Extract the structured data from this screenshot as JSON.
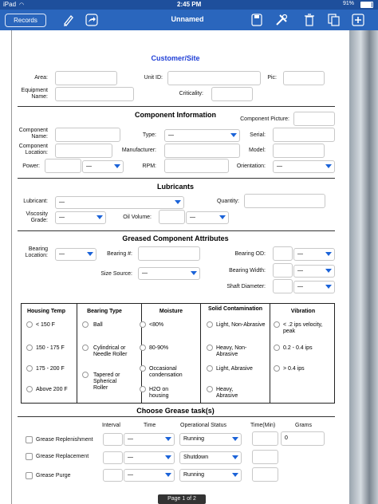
{
  "status": {
    "device": "iPad",
    "time": "2:45 PM",
    "battery": "91%"
  },
  "toolbar": {
    "records": "Records",
    "title": "Unnamed"
  },
  "customer": {
    "title": "Customer/Site",
    "area": "Area:",
    "unit_id": "Unit ID:",
    "pic": "Pic:",
    "equipment_name": "Equipment Name:",
    "criticality": "Criticality:"
  },
  "component": {
    "title": "Component Information",
    "picture": "Component Picture:",
    "name": "Component Name:",
    "type": "Type:",
    "type_value": "—",
    "serial": "Serial:",
    "location": "Component Location:",
    "manufacturer": "Manufacturer:",
    "model": "Model:",
    "power": "Power:",
    "power_unit": "—",
    "rpm": "RPM:",
    "orientation": "Orientation:",
    "orientation_value": "—"
  },
  "lubricants": {
    "title": "Lubricants",
    "lubricant": "Lubricant:",
    "lubricant_value": "—",
    "quantity": "Quantity:",
    "viscosity": "Viscosity Grade:",
    "viscosity_value": "—",
    "oil_volume": "Oil Volume:",
    "oil_volume_unit": "—"
  },
  "greased": {
    "title": "Greased Component Attributes",
    "bearing_location": "Bearing Location:",
    "bearing_location_value": "—",
    "bearing_no": "Bearing #:",
    "bearing_od": "Bearing OD:",
    "bearing_od_unit": "—",
    "size_source": "Size Source:",
    "size_source_value": "—",
    "bearing_width": "Bearing Width:",
    "bearing_width_unit": "—",
    "shaft_diameter": "Shaft Diameter:",
    "shaft_diameter_unit": "—"
  },
  "grid": {
    "columns": [
      {
        "header": "Housing Temp",
        "options": [
          "< 150 F",
          "150 - 175 F",
          "175 - 200 F",
          "Above 200 F"
        ]
      },
      {
        "header": "Bearing Type",
        "options": [
          "Ball",
          "Cylindrical or Needle Roller",
          "Tapered or Spherical Roller"
        ]
      },
      {
        "header": "Moisture",
        "options": [
          "<80%",
          "80-90%",
          "Occasional condensation",
          "H2O on housing"
        ]
      },
      {
        "header": "Solid Contamination",
        "options": [
          "Light, Non-Abrasive",
          "Heavy, Non-Abrasive",
          "Light, Abrasive",
          "Heavy, Abrasive"
        ]
      },
      {
        "header": "Vibration",
        "options": [
          "< .2 ips velocity, peak",
          "0.2 - 0.4 ips",
          "> 0.4 ips"
        ]
      }
    ]
  },
  "tasks": {
    "title": "Choose Grease task(s)",
    "headers": {
      "interval": "Interval",
      "time": "Time",
      "status": "Operational Status",
      "time_min": "Time(Min)",
      "grams": "Grams"
    },
    "rows": [
      {
        "name": "Grease Replenishment",
        "time": "—",
        "status": "Running",
        "grams": "0"
      },
      {
        "name": "Grease Replacement",
        "time": "—",
        "status": "Shutdown",
        "grams": ""
      },
      {
        "name": "Grease Purge",
        "time": "—",
        "status": "Running",
        "grams": ""
      }
    ]
  },
  "footer": {
    "page": "Page 1 of 2"
  },
  "colors": {
    "toolbar": "#2a66bd",
    "accent": "#1b63d8",
    "title_blue": "#1f3fd6"
  }
}
